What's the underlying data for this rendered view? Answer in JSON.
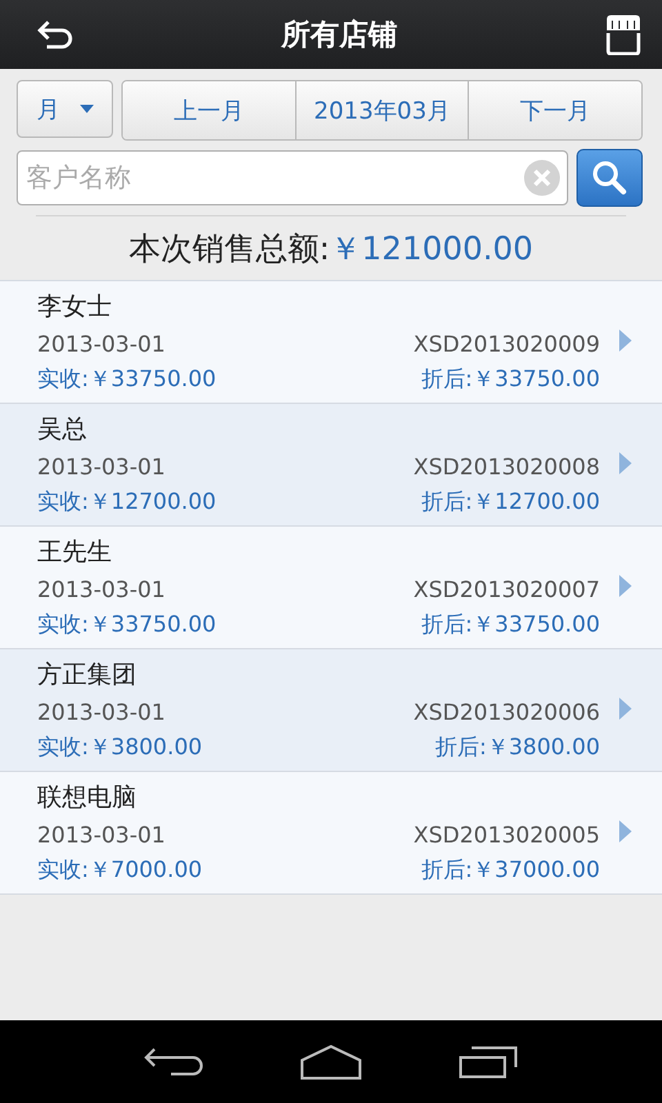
{
  "header": {
    "title": "所有店铺"
  },
  "period": {
    "unit": "月",
    "prev": "上一月",
    "current": "2013年03月",
    "next": "下一月"
  },
  "search": {
    "placeholder": "客户名称"
  },
  "total": {
    "label": "本次销售总额:",
    "amount": "￥121000.00"
  },
  "orders": [
    {
      "customer": "李女士",
      "date": "2013-03-01",
      "number": "XSD2013020009",
      "received": "实收:￥33750.00",
      "discounted": "折后:￥33750.00"
    },
    {
      "customer": "吴总",
      "date": "2013-03-01",
      "number": "XSD2013020008",
      "received": "实收:￥12700.00",
      "discounted": "折后:￥12700.00"
    },
    {
      "customer": "王先生",
      "date": "2013-03-01",
      "number": "XSD2013020007",
      "received": "实收:￥33750.00",
      "discounted": "折后:￥33750.00"
    },
    {
      "customer": "方正集团",
      "date": "2013-03-01",
      "number": "XSD2013020006",
      "received": "实收:￥3800.00",
      "discounted": "折后:￥3800.00"
    },
    {
      "customer": "联想电脑",
      "date": "2013-03-01",
      "number": "XSD2013020005",
      "received": "实收:￥7000.00",
      "discounted": "折后:￥37000.00"
    }
  ]
}
